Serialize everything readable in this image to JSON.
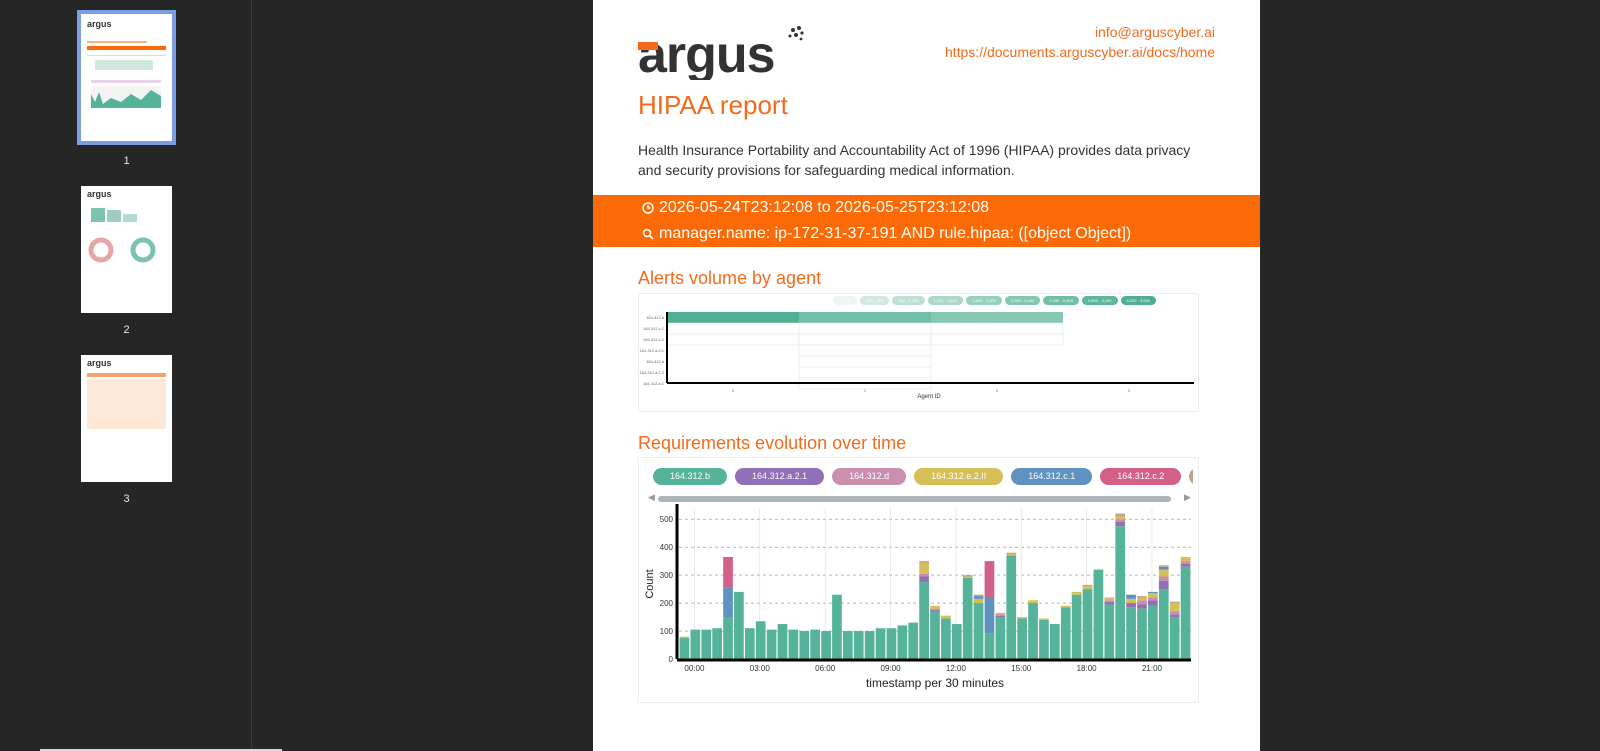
{
  "thumbnails": [
    {
      "page": "1"
    },
    {
      "page": "2"
    },
    {
      "page": "3"
    }
  ],
  "header": {
    "logo_text": "argus",
    "email": "info@arguscyber.ai",
    "docs_url": "https://documents.arguscyber.ai/docs/home"
  },
  "report": {
    "title": "HIPAA report",
    "description": "Health Insurance Portability and Accountability Act of 1996 (HIPAA) provides data privacy and security provisions for safeguarding medical information.",
    "time_range": "2026-05-24T23:12:08 to 2026-05-25T23:12:08",
    "query": "manager.name: ip-172-31-37-191 AND rule.hipaa: ([object Object])"
  },
  "colors": {
    "accent": "#f26b1d",
    "banner": "#fb6a07",
    "teal": "#54b399"
  },
  "heatmap": {
    "title": "Alerts volume by agent",
    "xlabel": "Agent ID",
    "x_ticks": [
      "0",
      "1",
      "2",
      "3"
    ],
    "rows": [
      "164.312.b",
      "164.312.c.1",
      "164.312.c.2",
      "164.312.a.2.1",
      "164.312.d",
      "164.312.a.2.2",
      "164.312.a.1"
    ],
    "legend": [
      "0 - 400",
      "400 - 800",
      "800 - 1,200",
      "1,200 - 1,600",
      "1,600 - 2,000",
      "2,000 - 2,400",
      "2,400 - 2,800",
      "2,800 - 3,200",
      "3,200 - 3,600"
    ],
    "legend_colors": [
      "#eef5f3",
      "#d2e8e2",
      "#bfe0d6",
      "#acd7ca",
      "#98cfbf",
      "#86c7b4",
      "#71bea8",
      "#5fb69d",
      "#4fae93"
    ]
  },
  "chart_data": {
    "type": "bar",
    "title": "Requirements evolution over time",
    "xlabel": "timestamp per 30 minutes",
    "ylabel": "Count",
    "ylim": [
      0,
      540
    ],
    "yticks": [
      0,
      100,
      200,
      300,
      400,
      500
    ],
    "xticks": [
      "00:00",
      "03:00",
      "06:00",
      "09:00",
      "12:00",
      "15:00",
      "18:00",
      "21:00"
    ],
    "categories": [
      "00:00",
      "00:30",
      "01:00",
      "01:30",
      "02:00",
      "02:30",
      "03:00",
      "03:30",
      "04:00",
      "04:30",
      "05:00",
      "05:30",
      "06:00",
      "06:30",
      "07:00",
      "07:30",
      "08:00",
      "08:30",
      "09:00",
      "09:30",
      "10:00",
      "10:30",
      "11:00",
      "11:30",
      "12:00",
      "12:30",
      "13:00",
      "13:30",
      "14:00",
      "14:30",
      "15:00",
      "15:30",
      "16:00",
      "16:30",
      "17:00",
      "17:30",
      "18:00",
      "18:30",
      "19:00",
      "19:30",
      "20:00",
      "20:30",
      "21:00",
      "21:30",
      "22:00",
      "22:30",
      "23:00"
    ],
    "series": [
      {
        "name": "164.312.b",
        "color": "#54b399",
        "values": [
          75,
          105,
          105,
          110,
          150,
          240,
          110,
          135,
          105,
          125,
          105,
          100,
          105,
          100,
          230,
          100,
          100,
          100,
          110,
          110,
          120,
          130,
          275,
          170,
          145,
          125,
          290,
          200,
          90,
          150,
          370,
          145,
          200,
          140,
          125,
          185,
          230,
          250,
          320,
          195,
          475,
          185,
          180,
          190,
          250,
          150,
          330
        ]
      },
      {
        "name": "164.312.a.2.1",
        "color": "#9170b8",
        "values": [
          0,
          0,
          0,
          0,
          0,
          0,
          0,
          0,
          0,
          0,
          0,
          0,
          0,
          0,
          0,
          0,
          0,
          0,
          0,
          0,
          0,
          0,
          20,
          5,
          0,
          0,
          0,
          0,
          0,
          5,
          0,
          0,
          0,
          0,
          0,
          0,
          0,
          0,
          0,
          10,
          15,
          15,
          15,
          20,
          30,
          10,
          10
        ]
      },
      {
        "name": "164.312.d",
        "color": "#ca8eae",
        "values": [
          0,
          0,
          0,
          0,
          0,
          0,
          0,
          0,
          0,
          0,
          0,
          0,
          0,
          0,
          0,
          0,
          0,
          0,
          0,
          0,
          0,
          0,
          10,
          5,
          0,
          0,
          0,
          0,
          0,
          5,
          0,
          0,
          0,
          0,
          0,
          0,
          0,
          0,
          0,
          5,
          10,
          0,
          15,
          10,
          15,
          10,
          10
        ]
      },
      {
        "name": "164.312.e.2.II",
        "color": "#d6bf57",
        "values": [
          5,
          0,
          0,
          0,
          0,
          0,
          0,
          0,
          0,
          0,
          0,
          0,
          0,
          0,
          0,
          0,
          0,
          0,
          0,
          0,
          0,
          0,
          40,
          10,
          10,
          0,
          5,
          15,
          0,
          5,
          5,
          5,
          10,
          5,
          0,
          5,
          10,
          10,
          0,
          10,
          10,
          15,
          10,
          15,
          25,
          30,
          15
        ]
      },
      {
        "name": "164.312.c.1",
        "color": "#6092c0",
        "values": [
          0,
          0,
          0,
          0,
          105,
          0,
          0,
          0,
          0,
          0,
          0,
          0,
          0,
          0,
          0,
          0,
          0,
          0,
          0,
          0,
          0,
          0,
          0,
          0,
          0,
          0,
          0,
          10,
          130,
          0,
          0,
          0,
          0,
          0,
          0,
          0,
          0,
          0,
          0,
          0,
          0,
          15,
          0,
          5,
          10,
          0,
          0
        ]
      },
      {
        "name": "164.312.c.2",
        "color": "#d36086",
        "values": [
          0,
          0,
          0,
          0,
          110,
          0,
          0,
          0,
          0,
          0,
          0,
          0,
          0,
          0,
          0,
          0,
          0,
          0,
          0,
          0,
          0,
          0,
          0,
          0,
          0,
          0,
          0,
          0,
          130,
          0,
          0,
          0,
          0,
          0,
          0,
          0,
          0,
          0,
          0,
          0,
          0,
          0,
          0,
          0,
          0,
          0,
          0
        ]
      },
      {
        "name": "164.312.a.1",
        "color": "#b9a888",
        "values": [
          0,
          0,
          0,
          0,
          0,
          0,
          0,
          0,
          0,
          0,
          0,
          0,
          0,
          0,
          0,
          0,
          0,
          0,
          0,
          0,
          0,
          0,
          5,
          0,
          0,
          0,
          5,
          5,
          0,
          0,
          5,
          0,
          0,
          0,
          0,
          0,
          0,
          5,
          0,
          0,
          10,
          0,
          5,
          0,
          5,
          5,
          0
        ]
      }
    ]
  }
}
